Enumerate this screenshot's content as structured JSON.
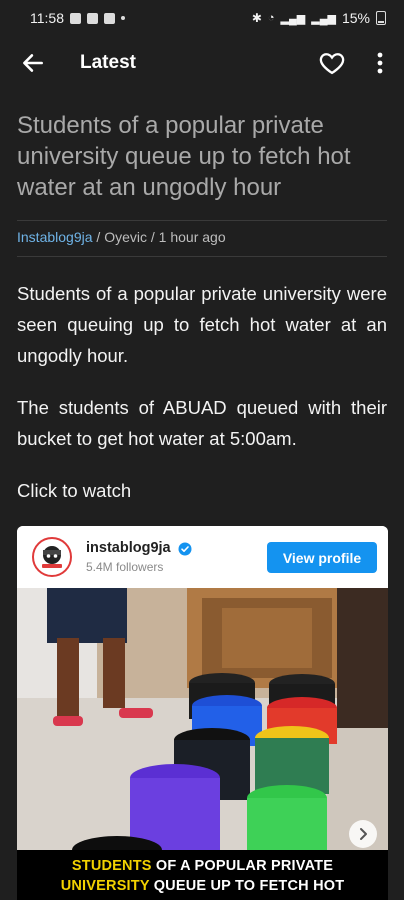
{
  "status_bar": {
    "time": "11:58",
    "battery": "15%"
  },
  "app_bar": {
    "title": "Latest"
  },
  "article": {
    "headline": "Students of a popular private university queue up to fetch hot water at an ungodly hour",
    "source": "Instablog9ja",
    "author": "Oyevic",
    "time_ago": "1 hour ago",
    "paragraphs": [
      "Students of a popular private university were seen queuing up to fetch hot water at an ungodly hour.",
      "The students of ABUAD queued with their bucket to get hot water at 5:00am.",
      "Click to watch"
    ]
  },
  "embed": {
    "username": "instablog9ja",
    "followers": "5.4M followers",
    "view_profile_label": "View profile",
    "caption_line1_highlight": "STUDENTS",
    "caption_line1_rest": "OF A POPULAR PRIVATE",
    "caption_line2_highlight": "UNIVERSITY",
    "caption_line2_rest": "QUEUE UP TO FETCH HOT"
  },
  "colors": {
    "background": "#1f1f1f",
    "headline": "#a9a9a9",
    "source_link": "#6fb3e6",
    "view_profile": "#1493f0",
    "caption_highlight": "#f2d200"
  }
}
